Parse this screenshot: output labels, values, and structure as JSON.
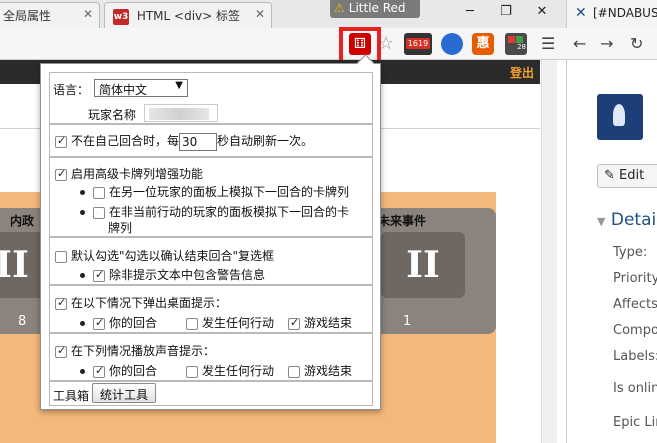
{
  "browser": {
    "tabs": [
      {
        "title": "全局属性"
      },
      {
        "title": "HTML <div> 标签",
        "favicon": "w3"
      }
    ],
    "profile": {
      "warning_icon": "warning-icon",
      "name": "Little Red"
    },
    "right_window": {
      "icon": "N",
      "title": "[#NDABUS"
    }
  },
  "page": {
    "login_link": "登出",
    "cards": [
      {
        "label": "内政",
        "count": "8",
        "glyph": "II"
      },
      {
        "label": "未来事件",
        "count": "1",
        "glyph": "II"
      }
    ]
  },
  "right_pane": {
    "edit_button": "Edit",
    "details_heading": "Detai",
    "fields": [
      "Type:",
      "Priority:",
      "Affects",
      "Compor",
      "Labels:",
      "Is online",
      "Epic Lin"
    ]
  },
  "popup": {
    "language_label": "语言：",
    "language_value": "简体中文",
    "player_name_label": "玩家名称",
    "refresh": {
      "checked": true,
      "prefix": "不在自己回合时，每",
      "value": "30",
      "suffix": "秒自动刷新一次。"
    },
    "advanced": {
      "checked": true,
      "label": "启用高级卡牌列增强功能",
      "options": [
        {
          "checked": false,
          "label": "在另一位玩家的面板上模拟下一回合的卡牌列"
        },
        {
          "checked": false,
          "label": "在非当前行动的玩家的面板模拟下一回合的卡",
          "label_line2": "牌列"
        }
      ]
    },
    "confirm": {
      "checked": false,
      "label": "默认勾选\"勾选以确认结束回合\"复选框",
      "options": [
        {
          "checked": true,
          "label": "除非提示文本中包含警告信息"
        }
      ]
    },
    "desktop_alert": {
      "checked": true,
      "label": "在以下情况下弹出桌面提示：",
      "options": [
        {
          "checked": true,
          "label": "你的回合"
        },
        {
          "checked": false,
          "label": "发生任何行动"
        },
        {
          "checked": true,
          "label": "游戏结束"
        }
      ]
    },
    "sound_alert": {
      "checked": true,
      "label": "在下列情况播放声音提示：",
      "options": [
        {
          "checked": true,
          "label": "你的回合"
        },
        {
          "checked": false,
          "label": "发生任何行动"
        },
        {
          "checked": false,
          "label": "游戏结束"
        }
      ]
    },
    "toolbox_label": "工具箱",
    "stats_button": "统计工具"
  },
  "colors": {
    "highlight": "#e82020",
    "page_orange": "#f4b87a",
    "card_gray": "#8a837e",
    "jira_blue": "#205081"
  }
}
